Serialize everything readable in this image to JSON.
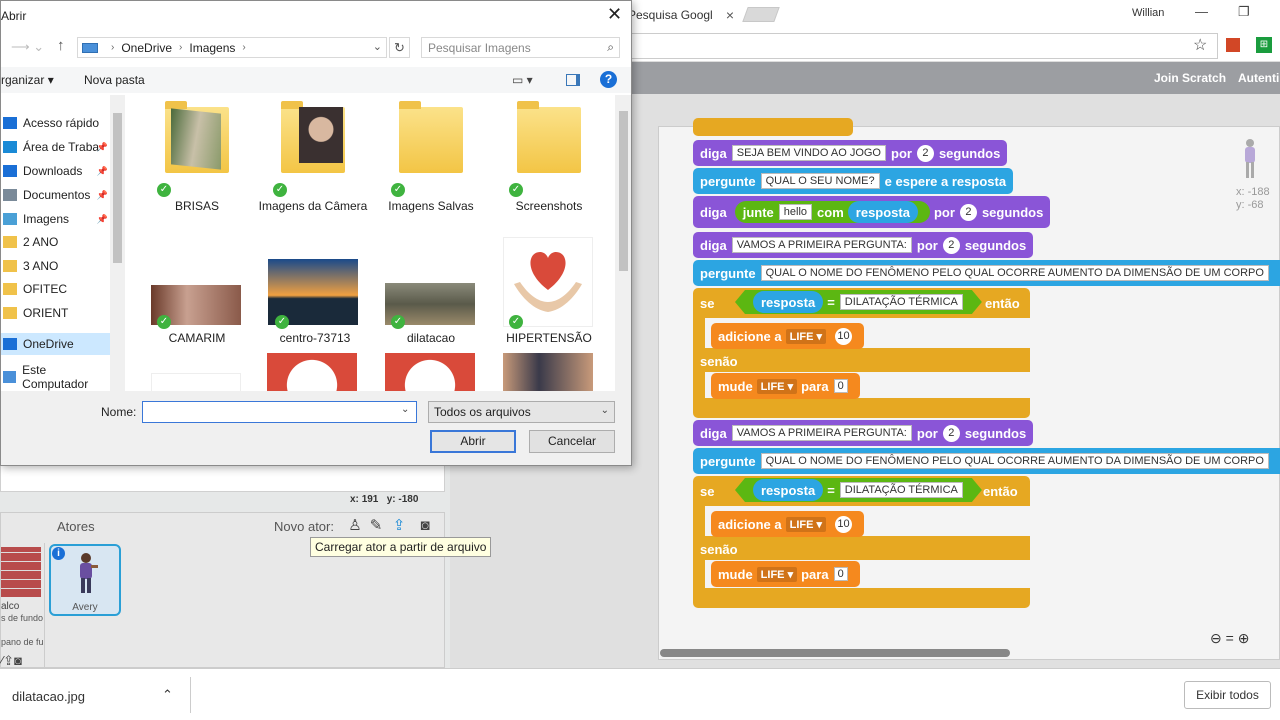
{
  "browser": {
    "tab_title": "Pesquisa Googl",
    "user": "Willian",
    "win_min": "—",
    "win_max": "❐",
    "win_close": "✕",
    "star": "☆"
  },
  "scratch_menu": {
    "join": "Join Scratch",
    "auth": "Autenti"
  },
  "stage": {
    "x_label": "x:",
    "x_value": "191",
    "y_label": "y:",
    "y_value": "-180"
  },
  "sprites": {
    "title": "Atores",
    "new_sprite": "Novo ator:",
    "tooltip": "Carregar ator a partir de arquivo",
    "stage_name": "alco",
    "stage_sub": "s de fundo",
    "new_backdrop": "pano de fu",
    "avery": "Avery",
    "icons": [
      "character-icon",
      "paint-brush-icon",
      "upload-icon",
      "camera-icon"
    ]
  },
  "script": {
    "sprite_x": "x: -188",
    "sprite_y": "y: -68",
    "blocks": {
      "diga": "diga",
      "por": "por",
      "segundos": "segundos",
      "pergunte": "pergunte",
      "e_espere": "e espere a resposta",
      "junte": "junte",
      "com": "com",
      "resposta": "resposta",
      "se": "se",
      "entao": "então",
      "senao": "senão",
      "adicione": "adicione",
      "a": "a",
      "mude": "mude",
      "para": "para",
      "eq": "=",
      "life": "LIFE",
      "welcome": "SEJA BEM VINDO AO JOGO",
      "two": "2",
      "ask_name": "QUAL O SEU NOME?",
      "hello": "hello",
      "first_q": "VAMOS A PRIMEIRA PERGUNTA:",
      "question": "QUAL O NOME DO FENÔMENO PELO QUAL OCORRE AUMENTO DA DIMENSÃO DE UM CORPO",
      "question2": "QUAL O NOME DO FENÔMENO PELO QUAL OCORRE AUMENTO DA DIMENSÃO DE UM CORPO",
      "answer": "DILATAÇÃO TÉRMICA",
      "ten": "10",
      "zero": "0"
    }
  },
  "dialog": {
    "title": "Abrir",
    "close": "✕",
    "path": [
      "OneDrive",
      "Imagens"
    ],
    "search_placeholder": "Pesquisar Imagens",
    "organize": "rganizar ▾",
    "new_folder": "Nova pasta",
    "help": "?",
    "nav": [
      {
        "label": "Acesso rápido",
        "pinned": false,
        "color": "#1a6fd6"
      },
      {
        "label": "Área de Traba",
        "pinned": true,
        "color": "#1a8ad6"
      },
      {
        "label": "Downloads",
        "pinned": true,
        "color": "#1a6fd6"
      },
      {
        "label": "Documentos",
        "pinned": true,
        "color": "#7a8a99"
      },
      {
        "label": "Imagens",
        "pinned": true,
        "color": "#4aa0d6"
      },
      {
        "label": "2 ANO",
        "pinned": false,
        "color": "#f0c24a"
      },
      {
        "label": "3 ANO",
        "pinned": false,
        "color": "#f0c24a"
      },
      {
        "label": "OFITEC",
        "pinned": false,
        "color": "#f0c24a"
      },
      {
        "label": "ORIENT",
        "pinned": false,
        "color": "#f0c24a"
      },
      {
        "label": "OneDrive",
        "pinned": false,
        "color": "#1a6fd6"
      },
      {
        "label": "Este Computador",
        "pinned": false,
        "color": "#4a90d9"
      }
    ],
    "files": [
      {
        "name": "BRISAS",
        "kind": "folder"
      },
      {
        "name": "Imagens da Câmera",
        "kind": "folder"
      },
      {
        "name": "Imagens Salvas",
        "kind": "folder"
      },
      {
        "name": "Screenshots",
        "kind": "folder"
      },
      {
        "name": "CAMARIM",
        "kind": "image"
      },
      {
        "name": "centro-73713",
        "kind": "image"
      },
      {
        "name": "dilatacao",
        "kind": "image"
      },
      {
        "name": "HIPERTENSÃO",
        "kind": "image"
      }
    ],
    "name_label": "Nome:",
    "name_value": "",
    "file_type": "Todos os arquivos",
    "open_button": "Abrir",
    "cancel_button": "Cancelar"
  },
  "downloads": {
    "file": "dilatacao.jpg",
    "show_all": "Exibir todos"
  }
}
